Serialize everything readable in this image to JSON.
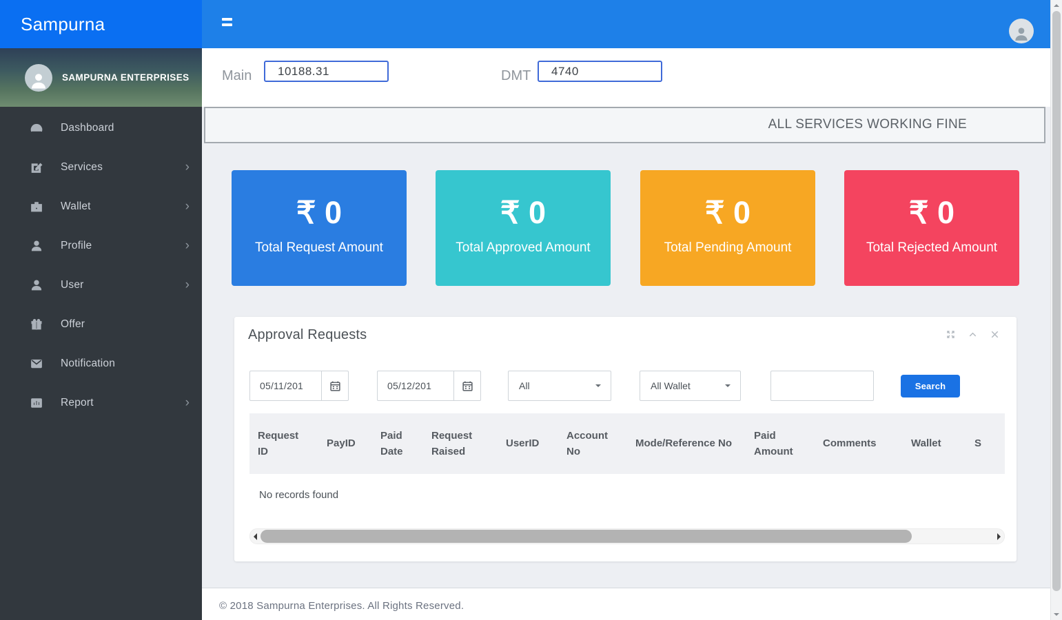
{
  "brand": {
    "logo_text": "Sampurna",
    "enterprise_name": "SAMPURNA ENTERPRISES"
  },
  "wallet_summary": {
    "main_label": "Main",
    "main_value": "10188.31",
    "dmt_label": "DMT",
    "dmt_value": "4740"
  },
  "status_banner": {
    "text": "ALL SERVICES WORKING FINE"
  },
  "sidebar": {
    "items": [
      {
        "label": "Dashboard",
        "icon": "gauge-icon",
        "has_submenu": false
      },
      {
        "label": "Services",
        "icon": "edit-icon",
        "has_submenu": true
      },
      {
        "label": "Wallet",
        "icon": "briefcase-icon",
        "has_submenu": true
      },
      {
        "label": "Profile",
        "icon": "user-icon",
        "has_submenu": true
      },
      {
        "label": "User",
        "icon": "user-icon",
        "has_submenu": true
      },
      {
        "label": "Offer",
        "icon": "gift-icon",
        "has_submenu": false
      },
      {
        "label": "Notification",
        "icon": "envelope-icon",
        "has_submenu": false
      },
      {
        "label": "Report",
        "icon": "chart-icon",
        "has_submenu": true
      }
    ]
  },
  "stat_cards": [
    {
      "amount": "₹ 0",
      "label": "Total Request Amount",
      "color": "#2a7de1",
      "style": "background:#2a7de1"
    },
    {
      "amount": "₹ 0",
      "label": "Total Approved Amount",
      "color": "#36c6cf",
      "style": "background:#36c6cf"
    },
    {
      "amount": "₹ 0",
      "label": "Total Pending Amount",
      "color": "#f7a723",
      "style": "background:#f7a723"
    },
    {
      "amount": "₹ 0",
      "label": "Total Rejected Amount",
      "color": "#f4445f",
      "style": "background:#f4445f"
    }
  ],
  "approval_panel": {
    "title": "Approval Requests",
    "tools": {
      "expand": "expand-icon",
      "collapse": "chevron-up-icon",
      "close": "close-icon"
    },
    "filters": {
      "date_from": "05/11/201",
      "date_to": "05/12/201",
      "status_select": "All",
      "wallet_select": "All Wallet",
      "search_value": "",
      "search_button_label": "Search"
    },
    "table": {
      "headers": [
        "Request ID",
        "PayID",
        "Paid Date",
        "Request Raised",
        "UserID",
        "Account No",
        "Mode/Reference No",
        "Paid Amount",
        "Comments",
        "Wallet",
        "S"
      ],
      "empty_message": "No records found"
    }
  },
  "footer": {
    "copyright": "© 2018 Sampurna Enterprises. All Rights Reserved."
  }
}
